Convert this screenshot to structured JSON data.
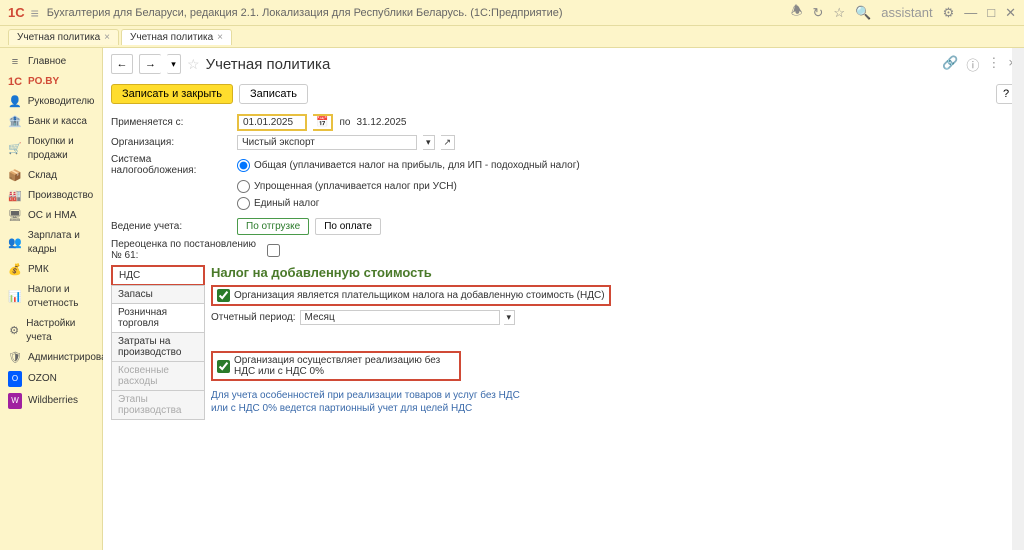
{
  "topbar": {
    "title": "Бухгалтерия для Беларуси, редакция 2.1. Локализация для Республики Беларусь. (1С:Предприятие)",
    "search": "assistant"
  },
  "tabs": [
    {
      "label": "Учетная политика"
    },
    {
      "label": "Учетная политика"
    }
  ],
  "sidebar": {
    "items": [
      {
        "icon": "≡",
        "label": "Главное"
      },
      {
        "icon": "1С",
        "label": "PO.BY",
        "cls": "poby"
      },
      {
        "icon": "👤",
        "label": "Руководителю"
      },
      {
        "icon": "🏦",
        "label": "Банк и касса"
      },
      {
        "icon": "🛒",
        "label": "Покупки и продажи"
      },
      {
        "icon": "📦",
        "label": "Склад"
      },
      {
        "icon": "🏭",
        "label": "Производство"
      },
      {
        "icon": "🖥",
        "label": "ОС и НМА"
      },
      {
        "icon": "👥",
        "label": "Зарплата и кадры"
      },
      {
        "icon": "💰",
        "label": "РМК"
      },
      {
        "icon": "📊",
        "label": "Налоги и отчетность"
      },
      {
        "icon": "⚙",
        "label": "Настройки учета"
      },
      {
        "icon": "🛡",
        "label": "Администрирование"
      },
      {
        "icon": "O",
        "label": "OZON"
      },
      {
        "icon": "W",
        "label": "Wildberries"
      }
    ]
  },
  "page": {
    "title": "Учетная политика",
    "save_close": "Записать и закрыть",
    "save": "Записать",
    "applies_from": "Применяется с:",
    "date_from": "01.01.2025",
    "to": "по",
    "date_to": "31.12.2025",
    "org_label": "Организация:",
    "org_value": "Чистый экспорт",
    "tax_label": "Система налогообложения:",
    "tax_general": "Общая (уплачивается налог на прибыль, для ИП - подоходный налог)",
    "tax_simplified": "Упрощенная (уплачивается налог при УСН)",
    "tax_single": "Единый налог",
    "accounting_label": "Ведение учета:",
    "by_shipment": "По отгрузке",
    "by_payment": "По оплате",
    "reval_label": "Переоценка по постановлению № 61:"
  },
  "subtabs": {
    "nds": "НДС",
    "zapasy": "Запасы",
    "retail": "Розничная торговля",
    "costs": "Затраты на производство",
    "indirect": "Косвенные расходы",
    "stages": "Этапы производства"
  },
  "vat": {
    "title": "Налог на добавленную стоимость",
    "check1": "Организация является плательщиком налога на добавленную стоимость (НДС)",
    "period_label": "Отчетный период:",
    "period_value": "Месяц",
    "check2": "Организация осуществляет реализацию без НДС или с НДС 0%",
    "info1": "Для учета особенностей при реализации товаров и услуг без НДС",
    "info2": "или с НДС 0% ведется партионный учет для целей НДС"
  }
}
